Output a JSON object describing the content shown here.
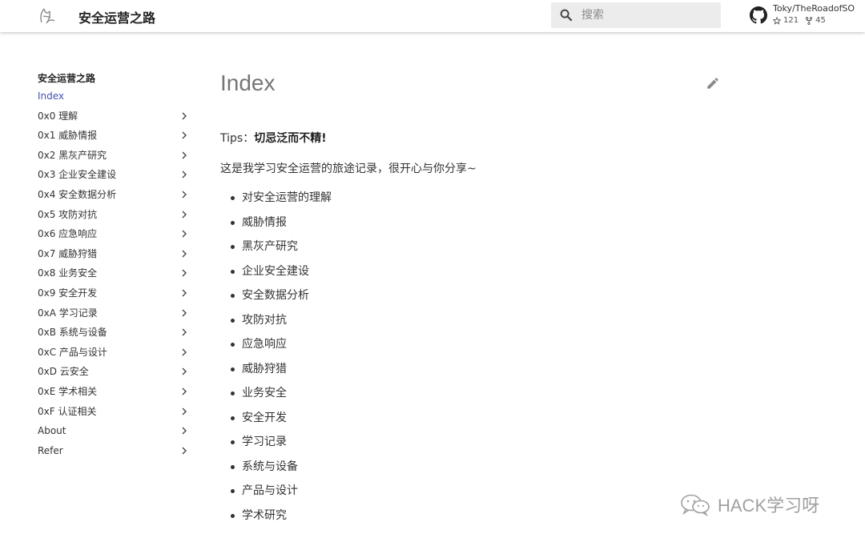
{
  "header": {
    "site_title": "安全运营之路",
    "search_placeholder": "搜索",
    "repo": {
      "name": "Toky/TheRoadofSO",
      "stars": "121",
      "forks": "45"
    }
  },
  "sidebar": {
    "title": "安全运营之路",
    "items": [
      {
        "label": "Index",
        "active": true,
        "expandable": false
      },
      {
        "label": "0x0 理解",
        "expandable": true
      },
      {
        "label": "0x1 威胁情报",
        "expandable": true
      },
      {
        "label": "0x2 黑灰产研究",
        "expandable": true
      },
      {
        "label": "0x3 企业安全建设",
        "expandable": true
      },
      {
        "label": "0x4 安全数据分析",
        "expandable": true
      },
      {
        "label": "0x5 攻防对抗",
        "expandable": true
      },
      {
        "label": "0x6 应急响应",
        "expandable": true
      },
      {
        "label": "0x7 威胁狩猎",
        "expandable": true
      },
      {
        "label": "0x8 业务安全",
        "expandable": true
      },
      {
        "label": "0x9 安全开发",
        "expandable": true
      },
      {
        "label": "0xA 学习记录",
        "expandable": true
      },
      {
        "label": "0xB 系统与设备",
        "expandable": true
      },
      {
        "label": "0xC 产品与设计",
        "expandable": true
      },
      {
        "label": "0xD 云安全",
        "expandable": true
      },
      {
        "label": "0xE 学术相关",
        "expandable": true
      },
      {
        "label": "0xF 认证相关",
        "expandable": true
      },
      {
        "label": "About",
        "expandable": true
      },
      {
        "label": "Refer",
        "expandable": true
      }
    ]
  },
  "main": {
    "title": "Index",
    "tips_prefix": "Tips：",
    "tips_bold": "切忌泛而不精!",
    "intro": "这是我学习安全运营的旅途记录，很开心与你分享~",
    "toc": [
      "对安全运营的理解",
      "威胁情报",
      "黑灰产研究",
      "企业安全建设",
      "安全数据分析",
      "攻防对抗",
      "应急响应",
      "威胁狩猎",
      "业务安全",
      "安全开发",
      "学习记录",
      "系统与设备",
      "产品与设计",
      "学术研究"
    ]
  },
  "watermark": {
    "text": "HACK学习呀"
  },
  "colors": {
    "accent": "#3f51b5",
    "text": "#333333",
    "title_gray": "#757575",
    "search_bg": "#ececec"
  },
  "icons": [
    "logo-icon",
    "search-icon",
    "github-icon",
    "star-icon",
    "fork-icon",
    "chevron-right-icon",
    "edit-icon",
    "wechat-icon"
  ]
}
